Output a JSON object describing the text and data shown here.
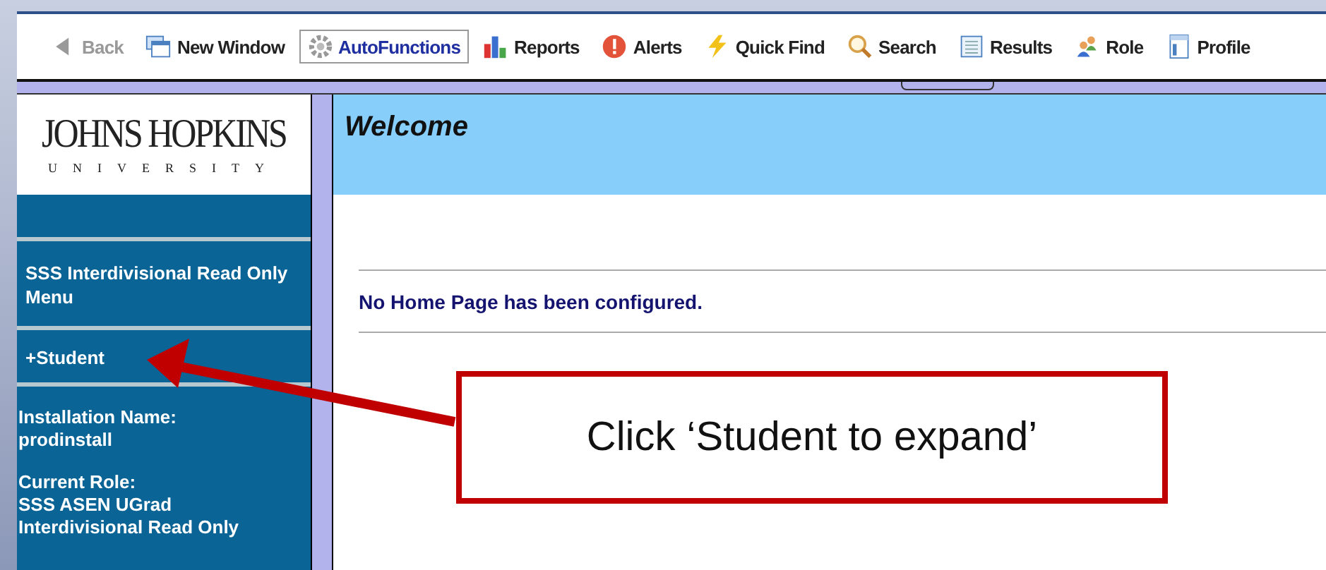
{
  "toolbar": {
    "items": [
      {
        "label": "Back",
        "disabled": true,
        "selected": false
      },
      {
        "label": "New Window",
        "disabled": false,
        "selected": false
      },
      {
        "label": "AutoFunctions",
        "disabled": false,
        "selected": true
      },
      {
        "label": "Reports",
        "disabled": false,
        "selected": false
      },
      {
        "label": "Alerts",
        "disabled": false,
        "selected": false
      },
      {
        "label": "Quick Find",
        "disabled": false,
        "selected": false
      },
      {
        "label": "Search",
        "disabled": false,
        "selected": false
      },
      {
        "label": "Results",
        "disabled": false,
        "selected": false
      },
      {
        "label": "Role",
        "disabled": false,
        "selected": false
      },
      {
        "label": "Profile",
        "disabled": false,
        "selected": false
      }
    ]
  },
  "sidebar": {
    "logo": {
      "name": "JOHNS HOPKINS",
      "subtitle": "UNIVERSITY"
    },
    "items": [
      {
        "kind": "menu",
        "text": "SSS Interdivisional Read Only Menu"
      },
      {
        "kind": "link",
        "text": "+Student"
      },
      {
        "kind": "info",
        "label": "Installation Name:",
        "value": "prodinstall"
      },
      {
        "kind": "info",
        "label": "Current Role:",
        "value": "SSS ASEN UGrad Interdivisional Read Only"
      }
    ]
  },
  "main": {
    "title": "Welcome",
    "message": "No Home Page has been configured."
  },
  "callout": {
    "text": "Click ‘Student to expand’"
  }
}
